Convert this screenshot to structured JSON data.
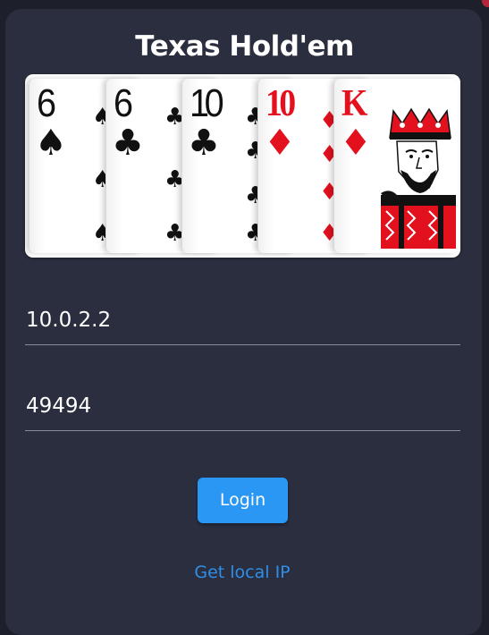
{
  "app": {
    "title": "Texas Hold'em"
  },
  "cards": [
    {
      "rank": "6",
      "suit": "♠",
      "color": "black"
    },
    {
      "rank": "6",
      "suit": "♣",
      "color": "black"
    },
    {
      "rank": "10",
      "suit": "♣",
      "color": "black"
    },
    {
      "rank": "10",
      "suit": "♦",
      "color": "red"
    },
    {
      "rank": "K",
      "suit": "♦",
      "color": "red"
    }
  ],
  "form": {
    "ip_value": "10.0.2.2",
    "port_value": "49494"
  },
  "actions": {
    "login_label": "Login",
    "get_ip_label": "Get local IP"
  },
  "colors": {
    "background": "#1d202b",
    "panel": "#2a2e3e",
    "accent": "#2997f3",
    "link": "#2f8fe8",
    "red_suit": "#e3101e"
  }
}
